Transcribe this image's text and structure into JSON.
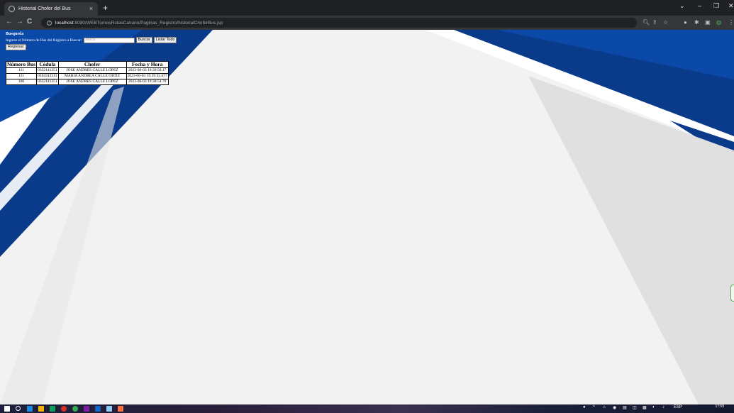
{
  "browser": {
    "tab_title": "Historial Chofer del Bus",
    "tab_close": "×",
    "new_tab": "+",
    "url_host": "localhost",
    "url_path": ":8080/WEBTurnosRutasCanario/Paginas_Registro/historialChoferBus.jsp",
    "nav": {
      "back": "←",
      "forward": "→",
      "reload": "C"
    }
  },
  "page": {
    "heading": "Busqueda",
    "search_label": "Ingrese el Número de Bus del Registro a Buscar:",
    "search_placeholder": "Buscar",
    "buscar_button": "Buscar",
    "listar_button": "Listar Todo",
    "regresar_button": "Regresar",
    "table": {
      "headers": [
        "Número Bus",
        "Cédula",
        "Chofer",
        "Fecha y Hora"
      ],
      "rows": [
        [
          "111",
          "0332141351",
          "JOSE ANDRES CALLE LOPEZ",
          "2023-06-03 19:39:58.17"
        ],
        [
          "111",
          "0104312311",
          "MARIA ANDREA CALLE ORTIZ",
          "2023-06-03 19:39:35.677"
        ],
        [
          "100",
          "0332141351",
          "JOSE ANDRES CALLE LOPEZ",
          "2023-06-03 19:38:54.78"
        ]
      ]
    }
  },
  "taskbar": {
    "time": "17:59",
    "lang": "ESP"
  },
  "colors": {
    "brand_blue": "#0a3a8a",
    "page_bg": "#f2f2f2"
  }
}
